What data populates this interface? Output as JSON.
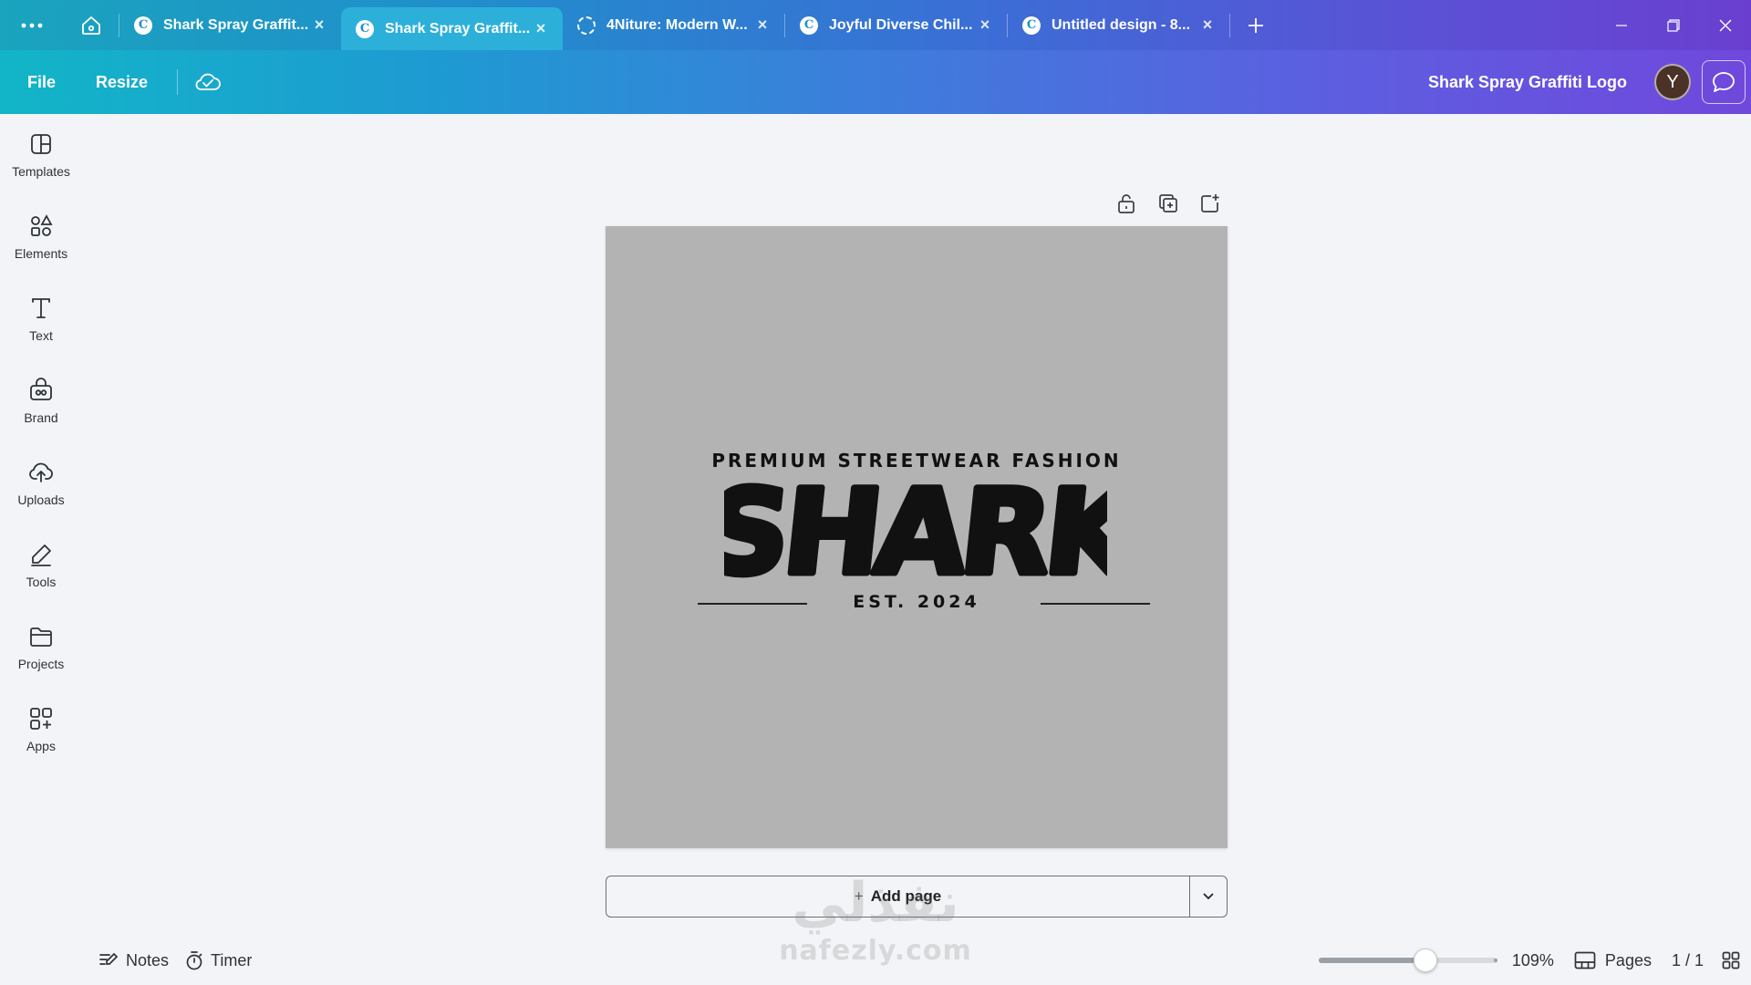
{
  "browser": {
    "tabs": [
      {
        "title": "Shark Spray Graffit...",
        "active": false,
        "icon": "canva-icon"
      },
      {
        "title": "Shark Spray Graffit...",
        "active": true,
        "icon": "canva-icon"
      },
      {
        "title": "4Niture: Modern W...",
        "active": false,
        "icon": "loading-icon"
      },
      {
        "title": "Joyful Diverse Chil...",
        "active": false,
        "icon": "canva-icon"
      },
      {
        "title": "Untitled design - 8...",
        "active": false,
        "icon": "canva-icon"
      }
    ],
    "favicon_letter": "C",
    "close_glyph": "×"
  },
  "toolbar": {
    "file_label": "File",
    "resize_label": "Resize",
    "doc_title": "Shark Spray Graffiti Logo",
    "avatar_initial": "Y"
  },
  "sidebar": {
    "items": [
      {
        "label": "Templates",
        "icon": "templates-icon"
      },
      {
        "label": "Elements",
        "icon": "elements-icon"
      },
      {
        "label": "Text",
        "icon": "text-icon"
      },
      {
        "label": "Brand",
        "icon": "brand-icon"
      },
      {
        "label": "Uploads",
        "icon": "uploads-icon"
      },
      {
        "label": "Tools",
        "icon": "tools-icon"
      },
      {
        "label": "Projects",
        "icon": "projects-icon"
      },
      {
        "label": "Apps",
        "icon": "apps-icon"
      }
    ]
  },
  "design": {
    "tagline": "PREMIUM STREETWEAR FASHION",
    "logo_text": "SHARK",
    "est": "EST. 2024",
    "background": "#b3b3b3"
  },
  "canvas": {
    "add_page_label": "Add page",
    "add_page_plus": "+"
  },
  "watermark": {
    "arabic": "نفذلي",
    "latin": "nafezly.com"
  },
  "bottombar": {
    "notes_label": "Notes",
    "timer_label": "Timer",
    "zoom_value": "109%",
    "zoom_fraction": 0.6,
    "pages_label": "Pages",
    "page_count": "1 / 1"
  },
  "colors": {
    "brand_gradient_start": "#12b5c8",
    "brand_gradient_end": "#7048dc",
    "active_tab": "#2cb0da"
  }
}
